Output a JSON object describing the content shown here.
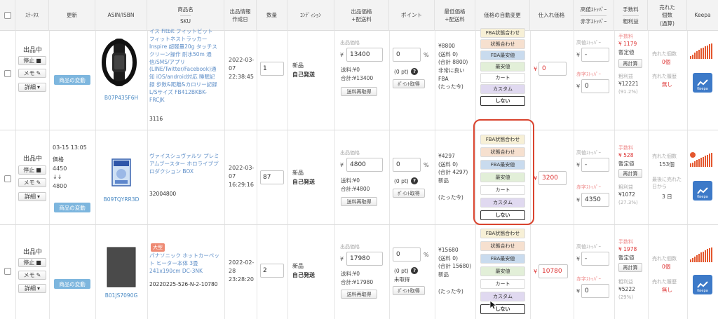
{
  "header": {
    "checkbox": "",
    "status": "ｽﾃｰﾀｽ",
    "update": "更新",
    "asin": "ASIN/ISBN",
    "product_name": "商品名",
    "sku": "SKU",
    "listing_info": "出品情報",
    "created_date": "作成日",
    "quantity": "数量",
    "condition": "ｺﾝﾃﾞｨｼｮﾝ",
    "listing_price": "出品価格",
    "listing_price_sub": "+配送料",
    "points": "ポイント",
    "lowest_price": "最低価格",
    "lowest_price_sub": "+配送料",
    "auto_change": "価格の自動変更",
    "purchase_price": "仕入れ価格",
    "high_stopper": "高値ｽﾄｯﾊﾟｰ",
    "red_stopper": "赤字ｽﾄｯﾊﾟｰ",
    "fee": "手数料",
    "gross_profit": "粗利益",
    "sold_count": "売れた",
    "sold_count2": "個数",
    "sold_count3": "(過算)",
    "keepa": "Keepa"
  },
  "common": {
    "status_active": "出品中",
    "stop_label": "停止",
    "memo_label": "メモ",
    "detail_label": "詳細",
    "change_label": "商品の変動",
    "listing_price_label": "出品価格",
    "yen": "¥",
    "percent": "%",
    "shipping": "送料:¥0",
    "recalc_shipping": "送料再取得",
    "points_fetch": "ﾎﾟｲﾝﾄ取得",
    "high_label": "高値ｽﾄｯﾊﾟｰ",
    "red_label": "赤字ｽﾄｯﾊﾟｰ",
    "fee_label": "手数料",
    "fixed_label": "暫定値",
    "recalc": "再計算",
    "gross_label": "粗利益",
    "sold_label": "売れた個数",
    "sold_since_label": "最後に売れた日から",
    "sold_rate_label": "売れた履歴",
    "keepa_btn": "Keepa",
    "auto_options": [
      "FBA状態合わせ",
      "状態合わせ",
      "FBA最安値",
      "最安値",
      "カート",
      "カスタム",
      "しない"
    ]
  },
  "rows": [
    {
      "asin": "B07P435F6H",
      "product_name": "イス Fitbit フィットビット フィットネストラッカー Inspire 超軽量20g タッチスクリーン操作 耐水50m 通信/SMS/アプリ(LINE/Twitter/Facebook)通知 iOS/android対応 睡眠記録 歩数&距離&カロリー記録 L/Sサイズ FB412BKBK-FRCJK",
      "sku": "3116",
      "created_date": "2022-03-07",
      "created_time": "22:38:45",
      "quantity": "1",
      "condition": "新品",
      "fulfillment": "自己発送",
      "price": "13400",
      "total": "合計:¥13400",
      "points": "0",
      "points_pt": "(0 pt)",
      "lowest_1": "¥8800",
      "lowest_2": "(送料 0)",
      "lowest_3": "(合計 8800)",
      "lowest_4": "非常に良い",
      "lowest_5": "FBA",
      "lowest_6": "(たった今)",
      "purchase": "0",
      "high": "-",
      "red": "0",
      "fee": "¥ 1179",
      "gross": "¥12221",
      "gross_pct": "(91.2%)",
      "sold": "0個",
      "sold_rate": "無し"
    },
    {
      "update_date": "03-15 13:05",
      "update_label": "価格",
      "update_from": "4450",
      "update_arrow": "↓↓",
      "update_to": "4800",
      "asin": "B09TQYRR3D",
      "product_name": "ヴァイスシュヴァルツ プレミアムブースター ホロライブプロダクション BOX",
      "sku": "32004800",
      "created_date": "2022-03-07",
      "created_time": "16:29:16",
      "quantity": "87",
      "condition": "新品",
      "fulfillment": "自己発送",
      "price": "4800",
      "total": "合計:¥4800",
      "points": "0",
      "points_pt": "(0 pt)",
      "lowest_1": "¥4297",
      "lowest_2": "(送料 0)",
      "lowest_3": "(合計 4297)",
      "lowest_4": "新品",
      "lowest_6": "(たった今)",
      "purchase": "3200",
      "high": "-",
      "red": "4350",
      "fee": "¥ 528",
      "gross": "¥1072",
      "gross_pct": "(27.3%)",
      "sold": "153個",
      "sold_days": "3 日"
    },
    {
      "badge": "大型",
      "asin": "B01JS7090G",
      "product_name": "パナソニック ホットカーペット ヒーター本体 3畳 241x190cm DC-3NK",
      "sku": "20220225-526-N-2-10780",
      "created_date": "2022-02-28",
      "created_time": "23:28:20",
      "quantity": "2",
      "condition": "新品",
      "fulfillment": "自己発送",
      "price": "17980",
      "total": "合計:¥17980",
      "points": "0",
      "points_pt": "(0 pt)",
      "points_status": "未取得",
      "lowest_1": "¥15680",
      "lowest_2": "(送料 0)",
      "lowest_3": "(合計 15680)",
      "lowest_4": "新品",
      "lowest_6": "(たった今)",
      "purchase": "10780",
      "high": "-",
      "red": "0",
      "fee": "¥ 1978",
      "gross": "¥5222",
      "gross_pct": "(29%)",
      "sold": "0個",
      "sold_rate": "無し"
    }
  ]
}
